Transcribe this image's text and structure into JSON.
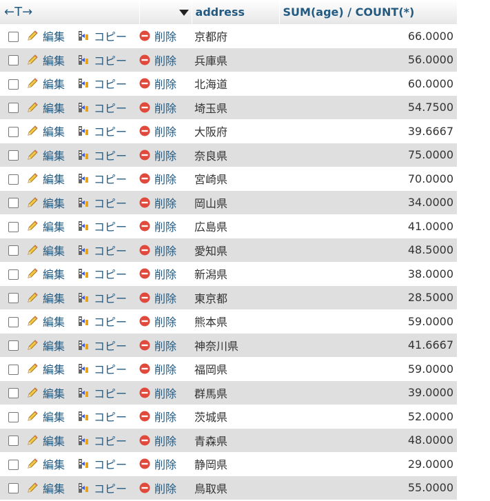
{
  "header": {
    "arrows": "←T→",
    "address": "address",
    "value": "SUM(age) / COUNT(*)"
  },
  "actions": {
    "edit": "編集",
    "copy": "コピー",
    "delete": "削除"
  },
  "rows": [
    {
      "address": "京都府",
      "value": "66.0000"
    },
    {
      "address": "兵庫県",
      "value": "56.0000"
    },
    {
      "address": "北海道",
      "value": "60.0000"
    },
    {
      "address": "埼玉県",
      "value": "54.7500"
    },
    {
      "address": "大阪府",
      "value": "39.6667"
    },
    {
      "address": "奈良県",
      "value": "75.0000"
    },
    {
      "address": "宮崎県",
      "value": "70.0000"
    },
    {
      "address": "岡山県",
      "value": "34.0000"
    },
    {
      "address": "広島県",
      "value": "41.0000"
    },
    {
      "address": "愛知県",
      "value": "48.5000"
    },
    {
      "address": "新潟県",
      "value": "38.0000"
    },
    {
      "address": "東京都",
      "value": "28.5000"
    },
    {
      "address": "熊本県",
      "value": "59.0000"
    },
    {
      "address": "神奈川県",
      "value": "41.6667"
    },
    {
      "address": "福岡県",
      "value": "59.0000"
    },
    {
      "address": "群馬県",
      "value": "39.0000"
    },
    {
      "address": "茨城県",
      "value": "52.0000"
    },
    {
      "address": "青森県",
      "value": "48.0000"
    },
    {
      "address": "静岡県",
      "value": "29.0000"
    },
    {
      "address": "鳥取県",
      "value": "55.0000"
    }
  ]
}
